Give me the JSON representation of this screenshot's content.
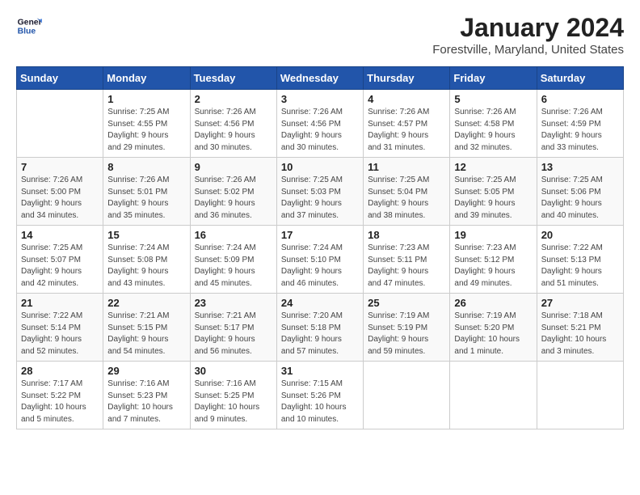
{
  "logo": {
    "line1": "General",
    "line2": "Blue"
  },
  "title": "January 2024",
  "subtitle": "Forestville, Maryland, United States",
  "days_of_week": [
    "Sunday",
    "Monday",
    "Tuesday",
    "Wednesday",
    "Thursday",
    "Friday",
    "Saturday"
  ],
  "weeks": [
    [
      {
        "day": "",
        "info": ""
      },
      {
        "day": "1",
        "info": "Sunrise: 7:25 AM\nSunset: 4:55 PM\nDaylight: 9 hours\nand 29 minutes."
      },
      {
        "day": "2",
        "info": "Sunrise: 7:26 AM\nSunset: 4:56 PM\nDaylight: 9 hours\nand 30 minutes."
      },
      {
        "day": "3",
        "info": "Sunrise: 7:26 AM\nSunset: 4:56 PM\nDaylight: 9 hours\nand 30 minutes."
      },
      {
        "day": "4",
        "info": "Sunrise: 7:26 AM\nSunset: 4:57 PM\nDaylight: 9 hours\nand 31 minutes."
      },
      {
        "day": "5",
        "info": "Sunrise: 7:26 AM\nSunset: 4:58 PM\nDaylight: 9 hours\nand 32 minutes."
      },
      {
        "day": "6",
        "info": "Sunrise: 7:26 AM\nSunset: 4:59 PM\nDaylight: 9 hours\nand 33 minutes."
      }
    ],
    [
      {
        "day": "7",
        "info": "Sunrise: 7:26 AM\nSunset: 5:00 PM\nDaylight: 9 hours\nand 34 minutes."
      },
      {
        "day": "8",
        "info": "Sunrise: 7:26 AM\nSunset: 5:01 PM\nDaylight: 9 hours\nand 35 minutes."
      },
      {
        "day": "9",
        "info": "Sunrise: 7:26 AM\nSunset: 5:02 PM\nDaylight: 9 hours\nand 36 minutes."
      },
      {
        "day": "10",
        "info": "Sunrise: 7:25 AM\nSunset: 5:03 PM\nDaylight: 9 hours\nand 37 minutes."
      },
      {
        "day": "11",
        "info": "Sunrise: 7:25 AM\nSunset: 5:04 PM\nDaylight: 9 hours\nand 38 minutes."
      },
      {
        "day": "12",
        "info": "Sunrise: 7:25 AM\nSunset: 5:05 PM\nDaylight: 9 hours\nand 39 minutes."
      },
      {
        "day": "13",
        "info": "Sunrise: 7:25 AM\nSunset: 5:06 PM\nDaylight: 9 hours\nand 40 minutes."
      }
    ],
    [
      {
        "day": "14",
        "info": "Sunrise: 7:25 AM\nSunset: 5:07 PM\nDaylight: 9 hours\nand 42 minutes."
      },
      {
        "day": "15",
        "info": "Sunrise: 7:24 AM\nSunset: 5:08 PM\nDaylight: 9 hours\nand 43 minutes."
      },
      {
        "day": "16",
        "info": "Sunrise: 7:24 AM\nSunset: 5:09 PM\nDaylight: 9 hours\nand 45 minutes."
      },
      {
        "day": "17",
        "info": "Sunrise: 7:24 AM\nSunset: 5:10 PM\nDaylight: 9 hours\nand 46 minutes."
      },
      {
        "day": "18",
        "info": "Sunrise: 7:23 AM\nSunset: 5:11 PM\nDaylight: 9 hours\nand 47 minutes."
      },
      {
        "day": "19",
        "info": "Sunrise: 7:23 AM\nSunset: 5:12 PM\nDaylight: 9 hours\nand 49 minutes."
      },
      {
        "day": "20",
        "info": "Sunrise: 7:22 AM\nSunset: 5:13 PM\nDaylight: 9 hours\nand 51 minutes."
      }
    ],
    [
      {
        "day": "21",
        "info": "Sunrise: 7:22 AM\nSunset: 5:14 PM\nDaylight: 9 hours\nand 52 minutes."
      },
      {
        "day": "22",
        "info": "Sunrise: 7:21 AM\nSunset: 5:15 PM\nDaylight: 9 hours\nand 54 minutes."
      },
      {
        "day": "23",
        "info": "Sunrise: 7:21 AM\nSunset: 5:17 PM\nDaylight: 9 hours\nand 56 minutes."
      },
      {
        "day": "24",
        "info": "Sunrise: 7:20 AM\nSunset: 5:18 PM\nDaylight: 9 hours\nand 57 minutes."
      },
      {
        "day": "25",
        "info": "Sunrise: 7:19 AM\nSunset: 5:19 PM\nDaylight: 9 hours\nand 59 minutes."
      },
      {
        "day": "26",
        "info": "Sunrise: 7:19 AM\nSunset: 5:20 PM\nDaylight: 10 hours\nand 1 minute."
      },
      {
        "day": "27",
        "info": "Sunrise: 7:18 AM\nSunset: 5:21 PM\nDaylight: 10 hours\nand 3 minutes."
      }
    ],
    [
      {
        "day": "28",
        "info": "Sunrise: 7:17 AM\nSunset: 5:22 PM\nDaylight: 10 hours\nand 5 minutes."
      },
      {
        "day": "29",
        "info": "Sunrise: 7:16 AM\nSunset: 5:23 PM\nDaylight: 10 hours\nand 7 minutes."
      },
      {
        "day": "30",
        "info": "Sunrise: 7:16 AM\nSunset: 5:25 PM\nDaylight: 10 hours\nand 9 minutes."
      },
      {
        "day": "31",
        "info": "Sunrise: 7:15 AM\nSunset: 5:26 PM\nDaylight: 10 hours\nand 10 minutes."
      },
      {
        "day": "",
        "info": ""
      },
      {
        "day": "",
        "info": ""
      },
      {
        "day": "",
        "info": ""
      }
    ]
  ]
}
